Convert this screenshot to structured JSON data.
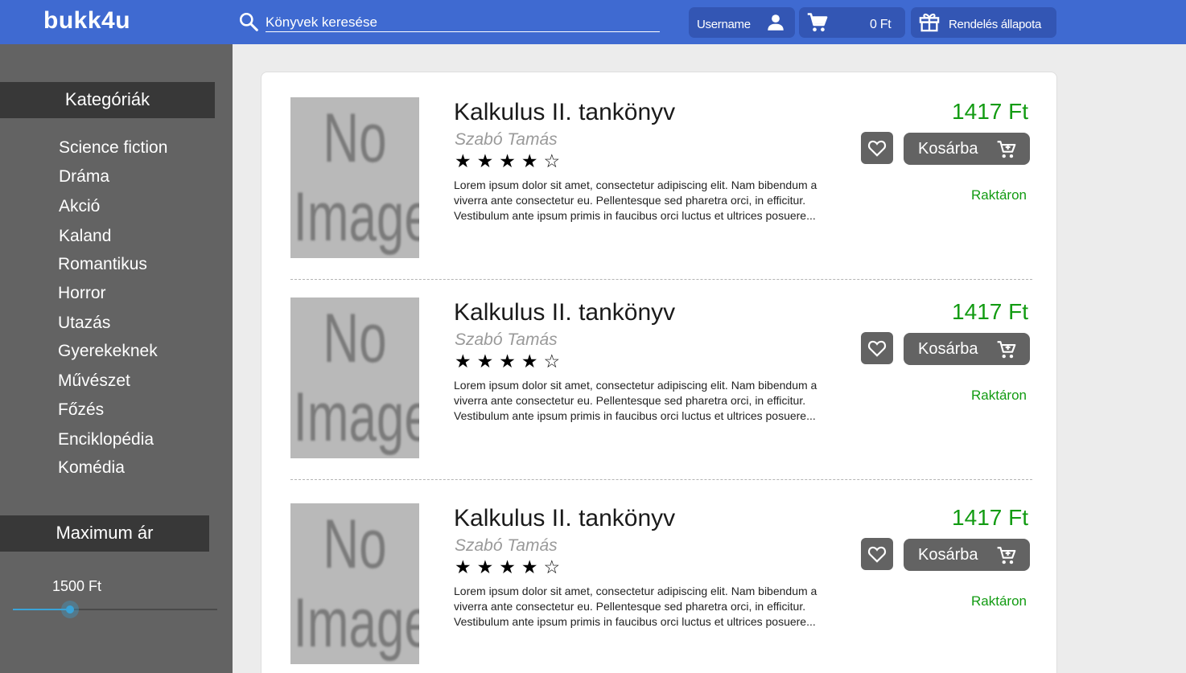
{
  "header": {
    "logo": "bukk4u",
    "search_placeholder": "Könyvek keresése",
    "user_label": "Username",
    "cart_total": "0 Ft",
    "order_status_label": "Rendelés állapota"
  },
  "sidebar": {
    "categories_title": "Kategóriák",
    "categories": [
      "Science fiction",
      "Dráma",
      "Akció",
      "Kaland",
      "Romantikus",
      "Horror",
      "Utazás",
      "Gyerekeknek",
      "Művészet",
      "Főzés",
      "Enciklopédia",
      "Komédia"
    ],
    "max_price_title": "Maximum ár",
    "max_price_value": "1500 Ft",
    "max_price_slider_fraction": 0.28
  },
  "products": [
    {
      "image_text_line1": "No",
      "image_text_line2": "Image",
      "title": "Kalkulus II. tankönyv",
      "author": "Szabó Tamás",
      "stars": "★★★★☆",
      "rating": 4,
      "description": "Lorem ipsum dolor sit amet, consectetur adipiscing elit. Nam bibendum a viverra ante consectetur eu. Pellentesque sed pharetra orci, in efficitur. Vestibulum ante ipsum primis in faucibus orci luctus et ultrices posuere...",
      "price": "1417 Ft",
      "add_to_cart_label": "Kosárba",
      "stock": "Raktáron"
    },
    {
      "image_text_line1": "No",
      "image_text_line2": "Image",
      "title": "Kalkulus II. tankönyv",
      "author": "Szabó Tamás",
      "stars": "★★★★☆",
      "rating": 4,
      "description": "Lorem ipsum dolor sit amet, consectetur adipiscing elit. Nam bibendum a viverra ante consectetur eu. Pellentesque sed pharetra orci, in efficitur. Vestibulum ante ipsum primis in faucibus orci luctus et ultrices posuere...",
      "price": "1417 Ft",
      "add_to_cart_label": "Kosárba",
      "stock": "Raktáron"
    },
    {
      "image_text_line1": "No",
      "image_text_line2": "Image",
      "title": "Kalkulus II. tankönyv",
      "author": "Szabó Tamás",
      "stars": "★★★★☆",
      "rating": 4,
      "description": "Lorem ipsum dolor sit amet, consectetur adipiscing elit. Nam bibendum a viverra ante consectetur eu. Pellentesque sed pharetra orci, in efficitur. Vestibulum ante ipsum primis in faucibus orci luctus et ultrices posuere...",
      "price": "1417 Ft",
      "add_to_cart_label": "Kosárba",
      "stock": "Raktáron"
    }
  ],
  "colors": {
    "header_bg": "#3f6ad1",
    "sidebar_bg": "#636363",
    "price_green": "#129b12",
    "slider_accent": "#3aa3d8"
  }
}
